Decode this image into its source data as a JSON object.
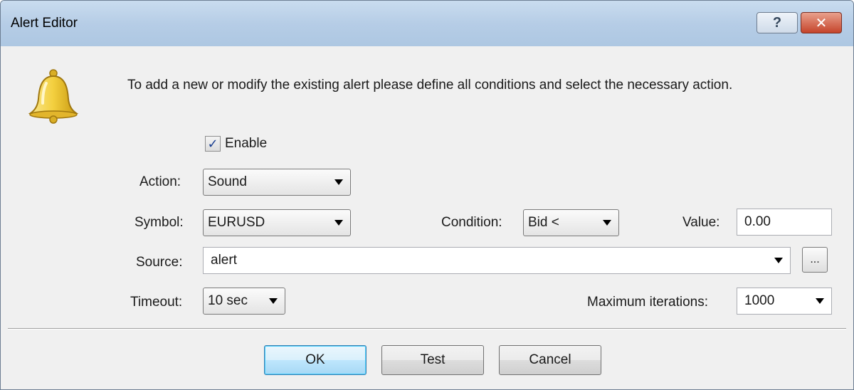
{
  "window": {
    "title": "Alert Editor",
    "help_glyph": "?",
    "close_glyph": "✕"
  },
  "intro_text": "To add a new or modify the existing alert please define all conditions and select the necessary action.",
  "enable": {
    "label": "Enable",
    "checked": true,
    "mark": "✓"
  },
  "action": {
    "label": "Action:",
    "value": "Sound"
  },
  "symbol": {
    "label": "Symbol:",
    "value": "EURUSD"
  },
  "condition": {
    "label": "Condition:",
    "value": "Bid <"
  },
  "value_field": {
    "label": "Value:",
    "value": "0.00"
  },
  "source": {
    "label": "Source:",
    "value": "alert",
    "browse_label": "..."
  },
  "timeout": {
    "label": "Timeout:",
    "value": "10 sec"
  },
  "max_iterations": {
    "label": "Maximum iterations:",
    "value": "1000"
  },
  "buttons": {
    "ok": "OK",
    "test": "Test",
    "cancel": "Cancel"
  },
  "icons": {
    "dialog": "bell-icon"
  },
  "colors": {
    "bell": "#f3cf3e",
    "ok_border": "#3c7fb1",
    "titlebar": "#b6cde6"
  }
}
